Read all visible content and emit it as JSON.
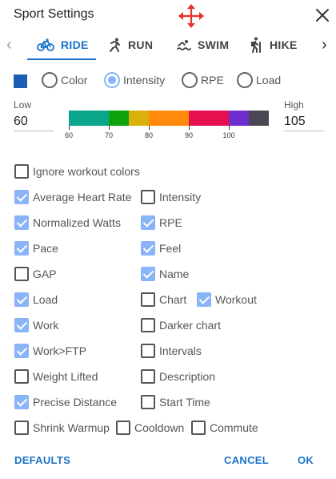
{
  "dialog": {
    "title": "Sport Settings"
  },
  "tabs": [
    {
      "label": "RIDE",
      "icon": "bike-icon",
      "active": true
    },
    {
      "label": "RUN",
      "icon": "run-icon",
      "active": false
    },
    {
      "label": "SWIM",
      "icon": "swim-icon",
      "active": false
    },
    {
      "label": "HIKE",
      "icon": "hike-icon",
      "active": false
    }
  ],
  "color_mode": {
    "swatch_color": "#1a5fb4",
    "options": [
      {
        "label": "Color",
        "checked": false
      },
      {
        "label": "Intensity",
        "checked": true
      },
      {
        "label": "RPE",
        "checked": false
      },
      {
        "label": "Load",
        "checked": false
      }
    ]
  },
  "range": {
    "low_label": "Low",
    "low_value": "60",
    "high_label": "High",
    "high_value": "105",
    "bands": [
      {
        "from": 60,
        "to": 70,
        "color": "#0aa58a"
      },
      {
        "from": 70,
        "to": 75,
        "color": "#0fa20f"
      },
      {
        "from": 75,
        "to": 80,
        "color": "#d9b00c"
      },
      {
        "from": 80,
        "to": 90,
        "color": "#ff8a0c"
      },
      {
        "from": 90,
        "to": 100,
        "color": "#e5104f"
      },
      {
        "from": 100,
        "to": 105,
        "color": "#6f2fce"
      },
      {
        "from": 105,
        "to": 110,
        "color": "#4b4654"
      }
    ],
    "ticks": [
      "60",
      "70",
      "80",
      "90",
      "100"
    ]
  },
  "options": {
    "ignore_colors": {
      "label": "Ignore workout colors",
      "checked": false
    },
    "avg_hr": {
      "label": "Average Heart Rate",
      "checked": true
    },
    "intensity": {
      "label": "Intensity",
      "checked": false
    },
    "normalized_watts": {
      "label": "Normalized Watts",
      "checked": true
    },
    "rpe": {
      "label": "RPE",
      "checked": true
    },
    "pace": {
      "label": "Pace",
      "checked": true
    },
    "feel": {
      "label": "Feel",
      "checked": true
    },
    "gap": {
      "label": "GAP",
      "checked": false
    },
    "name": {
      "label": "Name",
      "checked": true
    },
    "load": {
      "label": "Load",
      "checked": true
    },
    "chart": {
      "label": "Chart",
      "checked": false
    },
    "workout": {
      "label": "Workout",
      "checked": true
    },
    "work": {
      "label": "Work",
      "checked": true
    },
    "darker_chart": {
      "label": "Darker chart",
      "checked": false
    },
    "work_ftp": {
      "label": "Work>FTP",
      "checked": true
    },
    "intervals": {
      "label": "Intervals",
      "checked": false
    },
    "weight_lifted": {
      "label": "Weight Lifted",
      "checked": false
    },
    "description": {
      "label": "Description",
      "checked": false
    },
    "precise_distance": {
      "label": "Precise Distance",
      "checked": true
    },
    "start_time": {
      "label": "Start Time",
      "checked": false
    },
    "shrink_warmup": {
      "label": "Shrink Warmup",
      "checked": false
    },
    "cooldown": {
      "label": "Cooldown",
      "checked": false
    },
    "commute": {
      "label": "Commute",
      "checked": false
    }
  },
  "footer": {
    "defaults": "DEFAULTS",
    "cancel": "CANCEL",
    "ok": "OK"
  }
}
